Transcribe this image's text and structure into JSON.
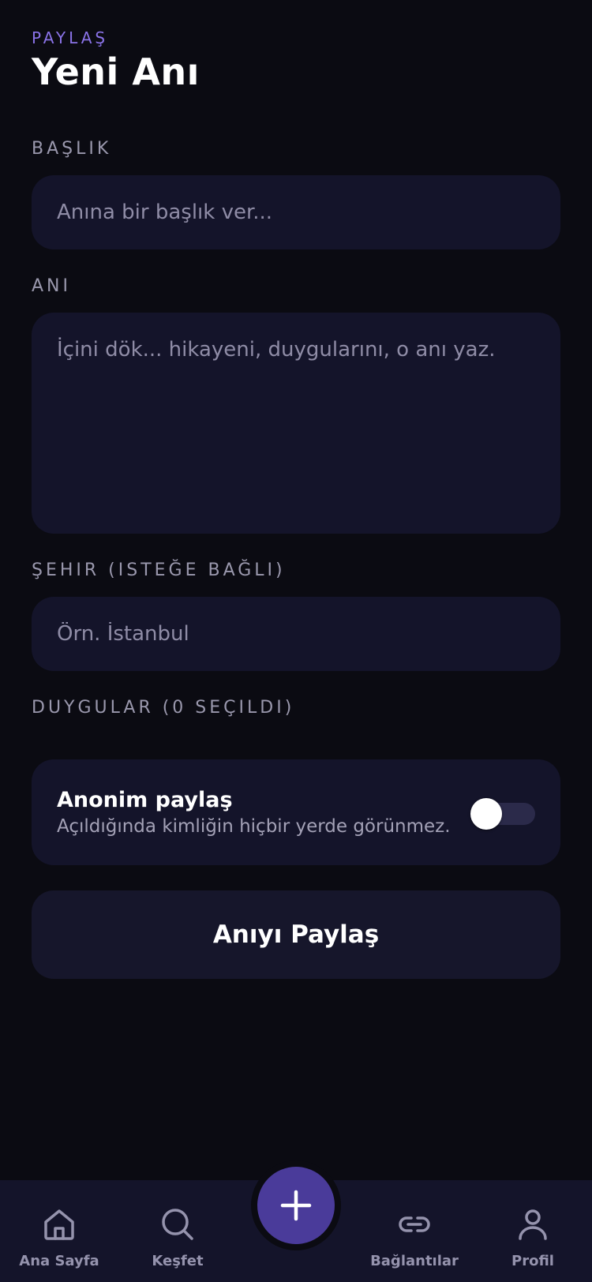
{
  "header": {
    "eyebrow": "PAYLAŞ",
    "title": "Yeni Anı"
  },
  "form": {
    "title_label": "BAŞLIK",
    "title_placeholder": "Anına bir başlık ver...",
    "memory_label": "ANI",
    "memory_placeholder": "İçini dök... hikayeni, duygularını, o anı yaz.",
    "city_label": "ŞEHIR (ISTEĞE BAĞLI)",
    "city_placeholder": "Örn. İstanbul",
    "emotions_label": "DUYGULAR (0 SEÇILDI)"
  },
  "anonymous": {
    "title": "Anonim paylaş",
    "subtitle": "Açıldığında kimliğin hiçbir yerde görünmez.",
    "enabled": false
  },
  "submit": {
    "label": "Anıyı Paylaş"
  },
  "tabbar": {
    "items": [
      {
        "label": "Ana Sayfa",
        "icon": "home-icon"
      },
      {
        "label": "Keşfet",
        "icon": "search-icon"
      },
      {
        "label": "",
        "icon": "plus-icon"
      },
      {
        "label": "Bağlantılar",
        "icon": "link-icon"
      },
      {
        "label": "Profil",
        "icon": "user-icon"
      }
    ]
  },
  "colors": {
    "background": "#0b0b12",
    "surface": "#14142a",
    "accent": "#8a73e8",
    "fab": "#4a3b9a"
  }
}
